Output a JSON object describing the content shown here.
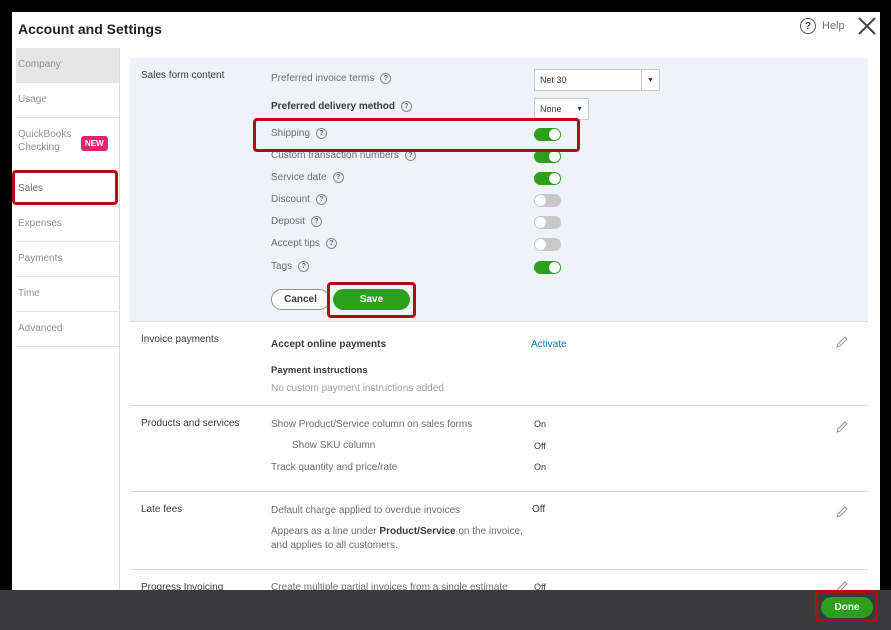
{
  "header": {
    "title": "Account and Settings",
    "help_label": "Help"
  },
  "sidebar": {
    "items": [
      {
        "label": "Company"
      },
      {
        "label": "Usage"
      },
      {
        "label": "QuickBooks Checking",
        "badge": "NEW"
      },
      {
        "label": "Sales"
      },
      {
        "label": "Expenses"
      },
      {
        "label": "Payments"
      },
      {
        "label": "Time"
      },
      {
        "label": "Advanced"
      }
    ],
    "active": "Sales"
  },
  "sales_form_content": {
    "section_label": "Sales form content",
    "preferred_invoice_terms": {
      "label": "Preferred invoice terms",
      "value": "Net 30"
    },
    "preferred_delivery_method": {
      "label": "Preferred delivery method",
      "value": "None"
    },
    "toggles": [
      {
        "label": "Shipping",
        "on": true
      },
      {
        "label": "Custom transaction numbers",
        "on": true
      },
      {
        "label": "Service date",
        "on": true
      },
      {
        "label": "Discount",
        "on": false
      },
      {
        "label": "Deposit",
        "on": false
      },
      {
        "label": "Accept tips",
        "on": false
      },
      {
        "label": "Tags",
        "on": true
      }
    ],
    "cancel_label": "Cancel",
    "save_label": "Save"
  },
  "invoice_payments": {
    "section_label": "Invoice payments",
    "accept_online": "Accept online payments",
    "activate_link": "Activate",
    "payment_instructions": "Payment instructions",
    "no_instructions": "No custom payment instructions added"
  },
  "products_services": {
    "section_label": "Products and services",
    "rows": [
      {
        "label": "Show Product/Service column on sales forms",
        "value": "On"
      },
      {
        "label": "Show SKU column",
        "value": "Off"
      },
      {
        "label": "Track quantity and price/rate",
        "value": "On"
      }
    ]
  },
  "late_fees": {
    "section_label": "Late fees",
    "label": "Default charge applied to overdue invoices",
    "value": "Off",
    "desc_prefix": "Appears as a line under",
    "desc_bold": "Product/Service",
    "desc_suffix": "on the invoice,",
    "desc_line2": "and applies to all customers."
  },
  "progress_invoicing": {
    "section_label": "Progress Invoicing",
    "label": "Create multiple partial invoices from a single estimate",
    "value": "Off"
  },
  "footer": {
    "done_label": "Done"
  },
  "colors": {
    "accent_green": "#2ca01c",
    "highlight_red": "#b20c14",
    "link_blue": "#0077c5"
  }
}
